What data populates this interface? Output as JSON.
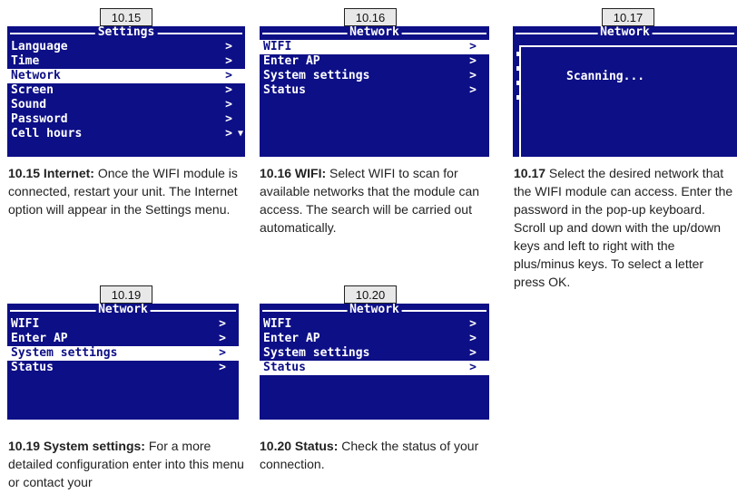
{
  "figures": [
    {
      "label": "10.15",
      "title": "Settings",
      "menu": [
        "Language",
        "Time",
        "Network",
        "Screen",
        "Sound",
        "Password",
        "Cell hours"
      ],
      "selected_index": 2,
      "chevron": ">",
      "scroll_indicator": "▼",
      "caption_bold": "10.15 Internet:",
      "caption_text": " Once the WIFI module is connected, restart your unit. The Internet option will appear in the Settings menu."
    },
    {
      "label": "10.16",
      "title": "Network",
      "menu": [
        "WIFI",
        "Enter AP",
        "System settings",
        "Status"
      ],
      "selected_index": 0,
      "chevron": ">",
      "caption_bold": "10.16 WIFI:",
      "caption_text": " Select WIFI to scan for available networks that the module can access. The search will be carried out automatically."
    },
    {
      "label": "10.17",
      "title": "Network",
      "dialog_text": "Scanning...",
      "caption_bold": "10.17",
      "caption_text": " Select the desired network that the WIFI module can access. Enter the password in the pop-up keyboard. Scroll up and down with the up/down keys and left to right with the plus/minus keys. To select a letter press OK."
    },
    {
      "label": "10.19",
      "title": "Network",
      "menu": [
        "WIFI",
        "Enter AP",
        "System settings",
        "Status"
      ],
      "selected_index": 2,
      "chevron": ">",
      "caption_bold": "10.19 System settings:",
      "caption_text": " For a more detailed configuration enter into this menu or contact your"
    },
    {
      "label": "10.20",
      "title": "Network",
      "menu": [
        "WIFI",
        "Enter AP",
        "System settings",
        "Status"
      ],
      "selected_index": 3,
      "chevron": ">",
      "caption_bold": "10.20 Status:",
      "caption_text": " Check the status of your connection."
    }
  ]
}
